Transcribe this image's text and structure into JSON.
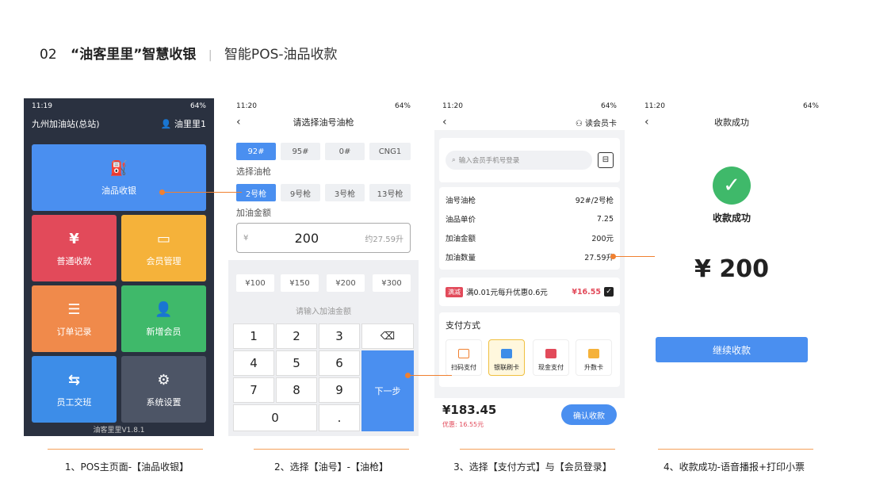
{
  "header": {
    "num": "02",
    "title": "“油客里里”智慧收银",
    "sep": "|",
    "sub": "智能POS-油品收款"
  },
  "status": {
    "p1_time": "11:19",
    "p2_time": "11:20",
    "p3_time": "11:20",
    "p4_time": "11:20",
    "battery": "64%"
  },
  "p1": {
    "station": "九州加油站(总站)",
    "user": "油里里1",
    "tiles": [
      "油品收银",
      "普通收款",
      "会员管理",
      "订单记录",
      "新增会员",
      "员工交班",
      "系统设置"
    ],
    "version": "油客里里V1.8.1"
  },
  "p2": {
    "title": "请选择油号油枪",
    "fuels": [
      "92#",
      "95#",
      "0#",
      "CNG1"
    ],
    "gun_label": "选择油枪",
    "guns": [
      "2号枪",
      "9号枪",
      "3号枪",
      "13号枪"
    ],
    "amount_label": "加油金额",
    "currency": "¥",
    "amount": "200",
    "approx": "约27.59升",
    "quick": [
      "¥100",
      "¥150",
      "¥200",
      "¥300"
    ],
    "keypad_hint": "请输入加油金额",
    "keys": [
      "1",
      "2",
      "3",
      "4",
      "5",
      "6",
      "7",
      "8",
      "9",
      "0",
      "."
    ],
    "next": "下一步"
  },
  "p3": {
    "member": "读会员卡",
    "search_placeholder": "输入会员手机号登录",
    "rows": [
      {
        "k": "油号油枪",
        "v": "92#/2号枪"
      },
      {
        "k": "油品单价",
        "v": "7.25"
      },
      {
        "k": "加油金额",
        "v": "200元"
      },
      {
        "k": "加油数量",
        "v": "27.59升"
      }
    ],
    "promo_tag": "满减",
    "promo": "满0.01元每升优惠0.6元",
    "promo_amt": "¥16.55",
    "pay_title": "支付方式",
    "pays": [
      "扫码支付",
      "银联刷卡",
      "现金支付",
      "升数卡"
    ],
    "total": "¥183.45",
    "discount": "优惠: 16.55元",
    "confirm": "确认收款"
  },
  "p4": {
    "title": "收款成功",
    "status": "收款成功",
    "amount": "¥ 200",
    "continue": "继续收款"
  },
  "captions": [
    "1、POS主页面-【油品收银】",
    "2、选择【油号】-【油枪】",
    "3、选择【支付方式】与【会员登录】",
    "4、收款成功-语音播报+打印小票"
  ],
  "colors": {
    "blue": "#4a8ff0",
    "orange": "#f08030",
    "red": "#e24a5a",
    "green": "#3fb96a",
    "yellow": "#f5b23a"
  }
}
